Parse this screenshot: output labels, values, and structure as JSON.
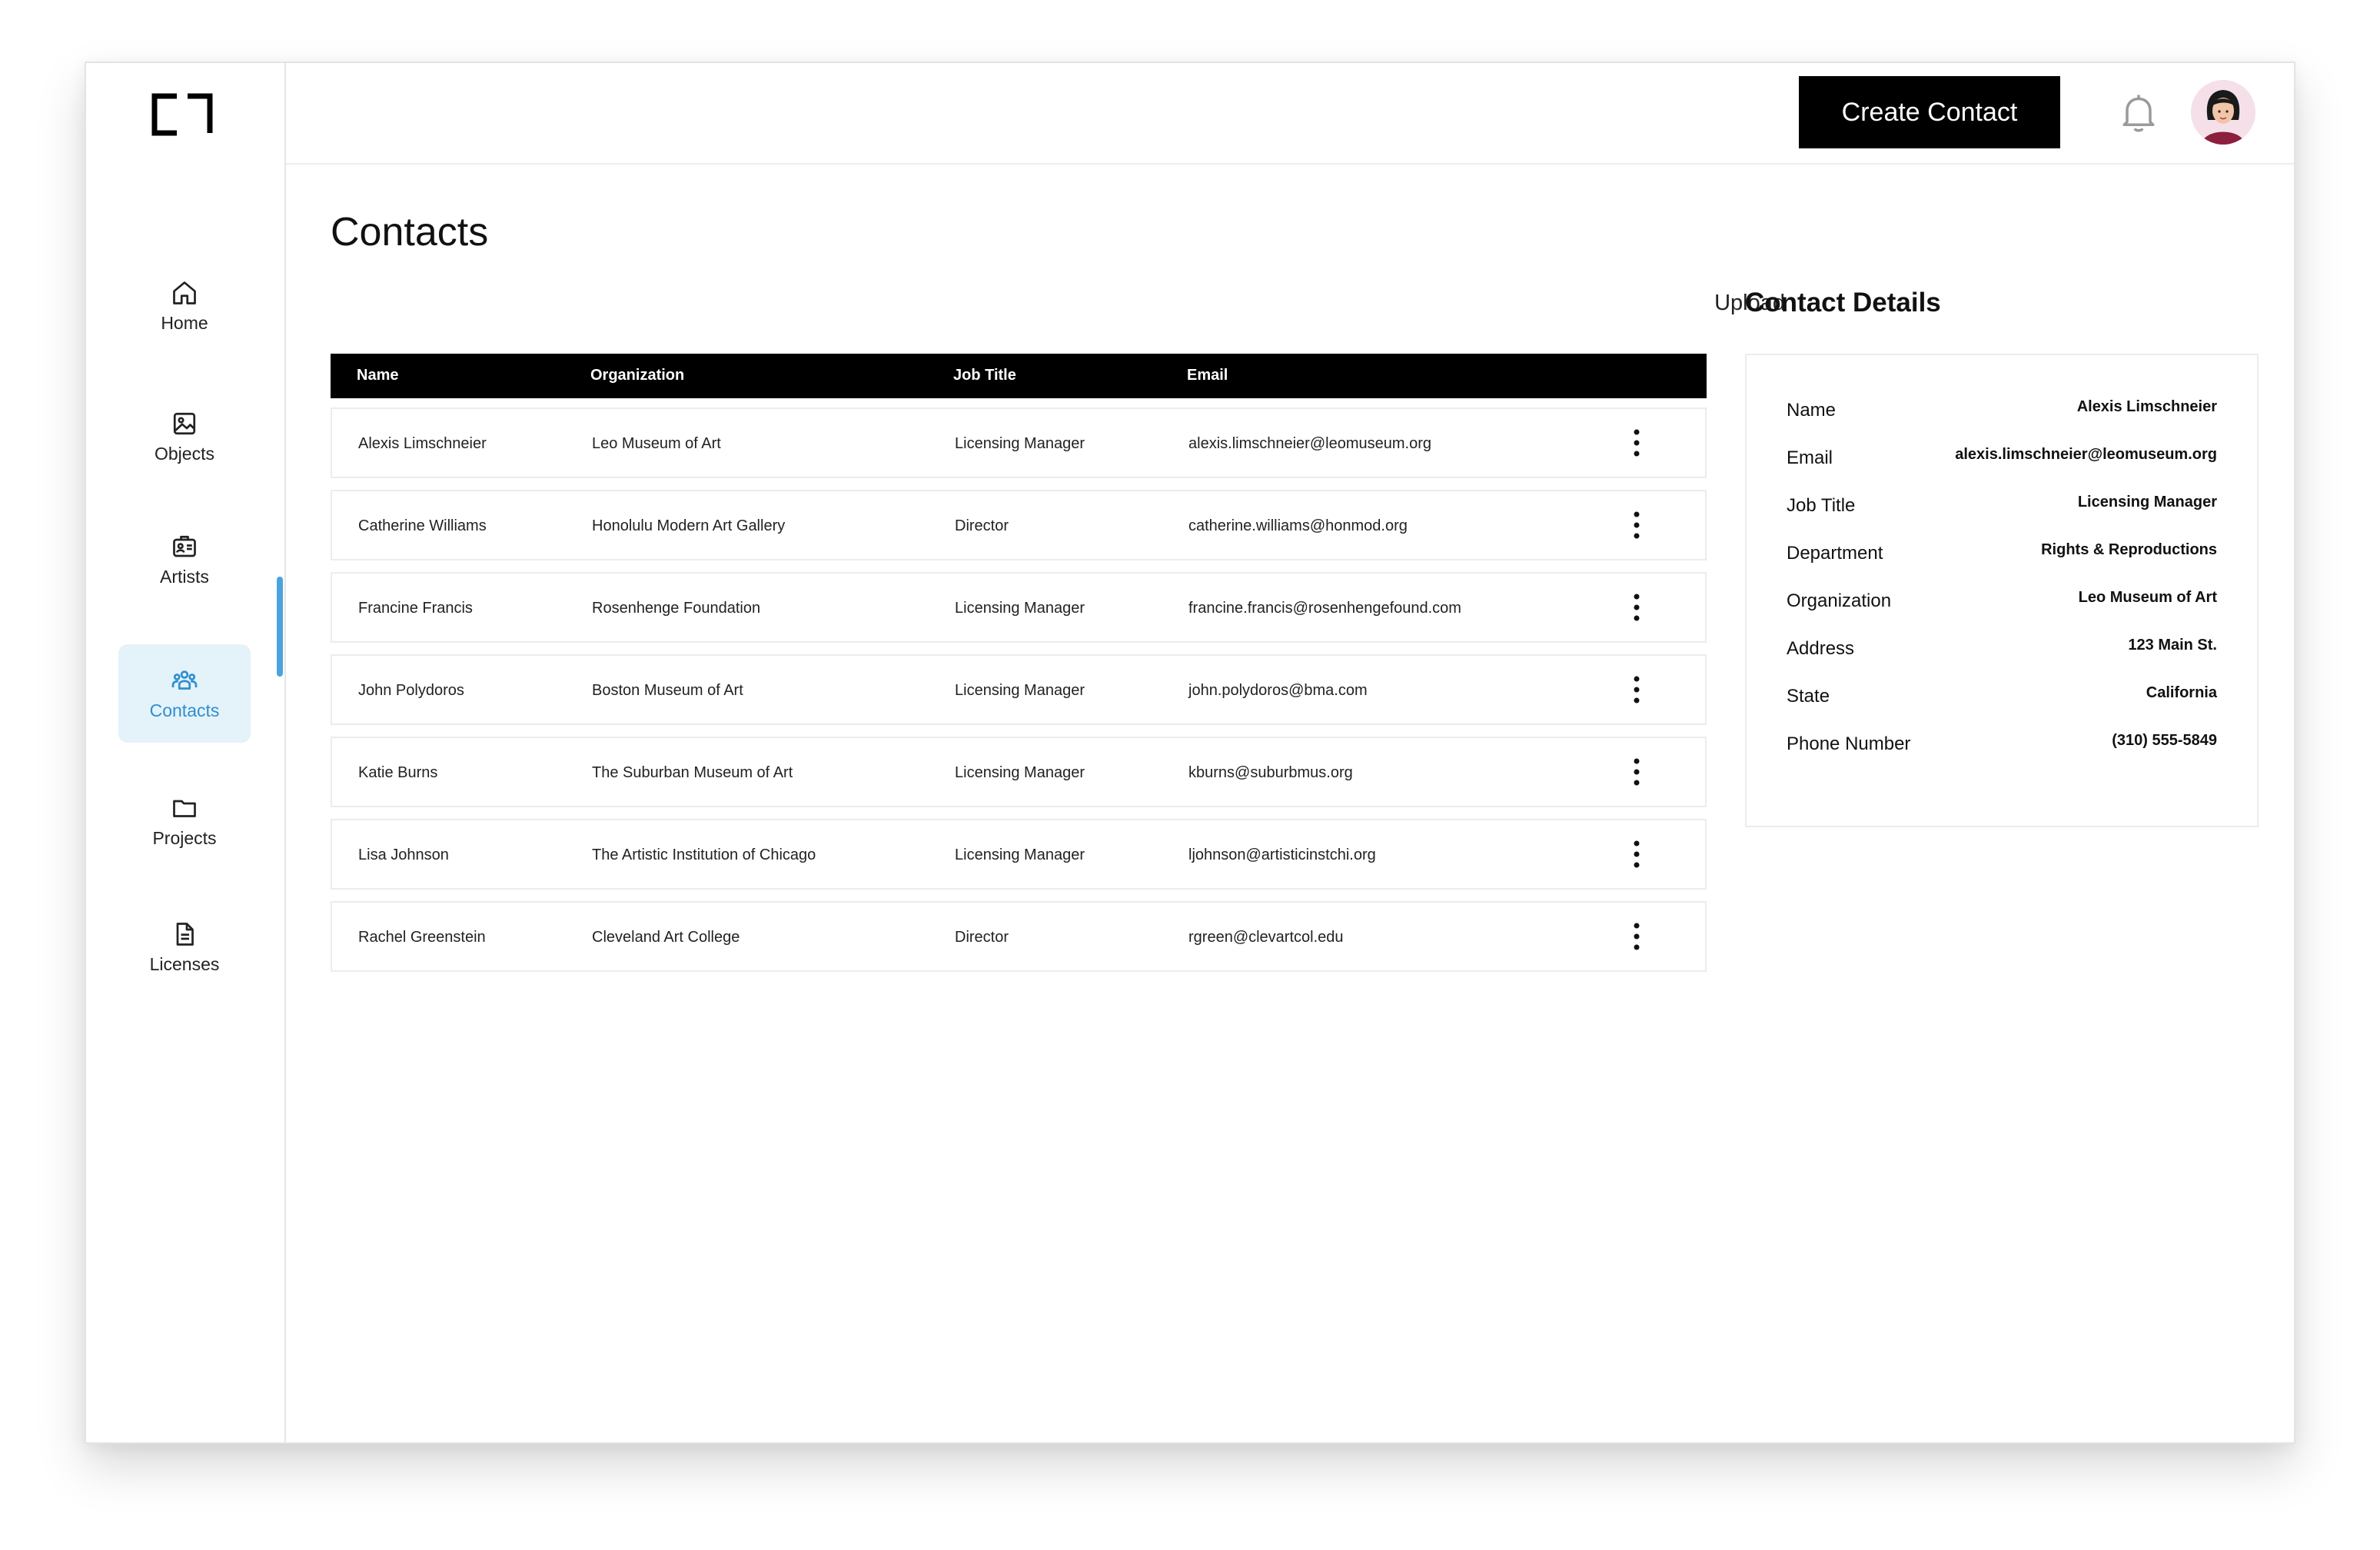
{
  "sidebar": {
    "items": [
      {
        "label": "Home",
        "icon": "home-icon"
      },
      {
        "label": "Objects",
        "icon": "image-icon"
      },
      {
        "label": "Artists",
        "icon": "id-card-icon"
      },
      {
        "label": "Contacts",
        "icon": "people-icon",
        "active": true
      },
      {
        "label": "Projects",
        "icon": "folder-icon"
      },
      {
        "label": "Licenses",
        "icon": "document-icon"
      }
    ]
  },
  "header": {
    "create_label": "Create Contact",
    "bell_icon": "bell-icon",
    "avatar_icon": "user-avatar"
  },
  "main": {
    "title": "Contacts",
    "upload_label": "Upload",
    "columns": [
      "Name",
      "Organization",
      "Job Title",
      "Email"
    ],
    "rows": [
      {
        "name": "Alexis Limschneier",
        "organization": "Leo Museum of Art",
        "job_title": "Licensing Manager",
        "email": "alexis.limschneier@leomuseum.org"
      },
      {
        "name": "Catherine Williams",
        "organization": "Honolulu Modern Art Gallery",
        "job_title": "Director",
        "email": "catherine.williams@honmod.org"
      },
      {
        "name": "Francine Francis",
        "organization": "Rosenhenge Foundation",
        "job_title": "Licensing Manager",
        "email": "francine.francis@rosenhengefound.com"
      },
      {
        "name": "John Polydoros",
        "organization": "Boston Museum of Art",
        "job_title": "Licensing Manager",
        "email": "john.polydoros@bma.com"
      },
      {
        "name": "Katie Burns",
        "organization": "The Suburban Museum of Art",
        "job_title": "Licensing Manager",
        "email": "kburns@suburbmus.org"
      },
      {
        "name": "Lisa Johnson",
        "organization": "The Artistic Institution of Chicago",
        "job_title": "Licensing Manager",
        "email": "ljohnson@artisticinstchi.org"
      },
      {
        "name": "Rachel Greenstein",
        "organization": "Cleveland Art College",
        "job_title": "Director",
        "email": "rgreen@clevartcol.edu"
      }
    ]
  },
  "details": {
    "title": "Contact Details",
    "fields": [
      {
        "label": "Name",
        "value": "Alexis Limschneier"
      },
      {
        "label": "Email",
        "value": "alexis.limschneier@leomuseum.org"
      },
      {
        "label": "Job Title",
        "value": "Licensing Manager"
      },
      {
        "label": "Department",
        "value": "Rights & Reproductions"
      },
      {
        "label": "Organization",
        "value": "Leo Museum of Art"
      },
      {
        "label": "Address",
        "value": "123 Main St."
      },
      {
        "label": "State",
        "value": "California"
      },
      {
        "label": "Phone Number",
        "value": "(310) 555-5849"
      }
    ]
  },
  "colors": {
    "accent": "#4aa3df",
    "active_bg": "#e4f2fa",
    "header_bg": "#000000"
  }
}
